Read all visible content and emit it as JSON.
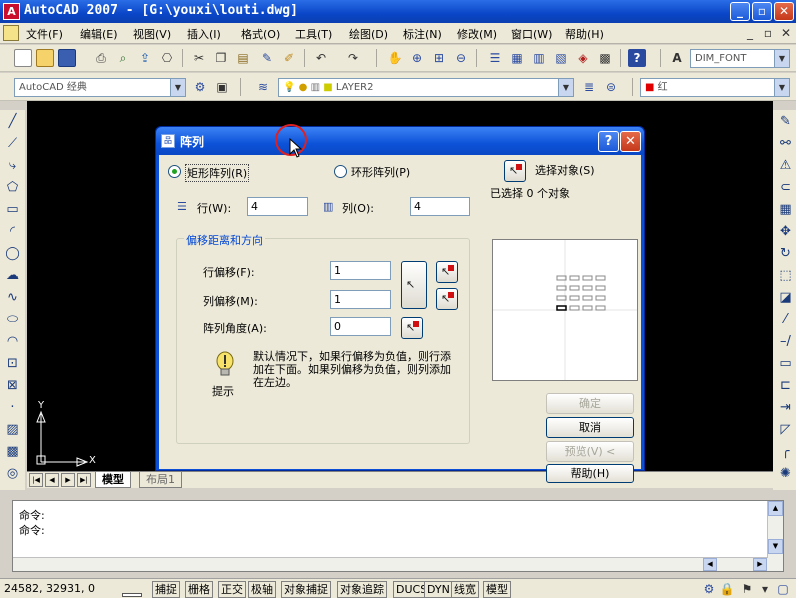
{
  "window": {
    "title": "AutoCAD 2007 - [G:\\youxi\\louti.dwg]",
    "min_label": "_",
    "restore_label": "▫",
    "close_label": "✕",
    "app_icon": "A"
  },
  "menubar": {
    "items": [
      "文件(F)",
      "编辑(E)",
      "视图(V)",
      "插入(I)",
      "格式(O)",
      "工具(T)",
      "绘图(D)",
      "标注(N)",
      "修改(M)",
      "窗口(W)",
      "帮助(H)"
    ],
    "doc_controls": [
      "_",
      "▫",
      "✕"
    ]
  },
  "toolbar": {
    "text_style": "DIM_FONT",
    "workspace": "AutoCAD 经典",
    "layer": "LAYER2",
    "color": "红"
  },
  "tabs": {
    "model": "模型",
    "layout1": "布局1"
  },
  "ucs": {
    "y_label": "Y",
    "x_label": "X"
  },
  "command": {
    "lines": [
      "命令:",
      "命令:"
    ]
  },
  "status": {
    "coords": "24582, 32931, 0",
    "buttons": [
      "捕捉",
      "栅格",
      "正交",
      "极轴",
      "对象捕捉",
      "对象追踪",
      "DUCS",
      "DYN",
      "线宽",
      "模型"
    ]
  },
  "dialog": {
    "title": "阵列",
    "title_icon": "品",
    "help_label": "?",
    "close_label": "✕",
    "rect_array_label": "矩形阵列(R)",
    "polar_array_label": "环形阵列(P)",
    "select_objects_label": "选择对象(S)",
    "selected_count_label": "已选择 0 个对象",
    "rows_label": "行(W):",
    "rows_value": "4",
    "cols_label": "列(O):",
    "cols_value": "4",
    "offset_group_label": "偏移距离和方向",
    "row_offset_label": "行偏移(F):",
    "row_offset_value": "1",
    "col_offset_label": "列偏移(M):",
    "col_offset_value": "1",
    "angle_label": "阵列角度(A):",
    "angle_value": "0",
    "tip_label": "提示",
    "tip_text": "默认情况下，如果行偏移为负值，则行添加在下面。如果列偏移为负值，则列添加在左边。",
    "ok_label": "确定",
    "cancel_label": "取消",
    "preview_label": "预览(V) <",
    "help_button_label": "帮助(H)"
  }
}
